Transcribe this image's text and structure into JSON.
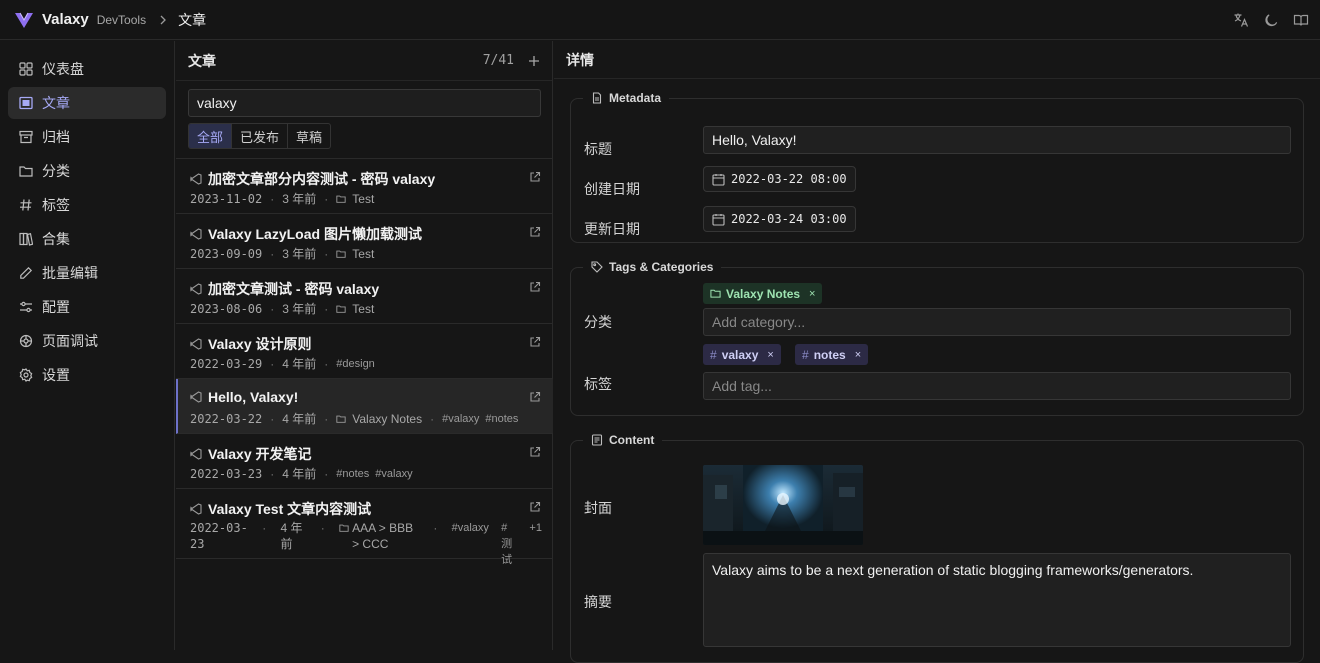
{
  "topbar": {
    "brand": "Valaxy",
    "sub": "DevTools",
    "crumb": "文章",
    "icons": [
      "translate-icon",
      "moon-icon",
      "book-icon"
    ]
  },
  "sidebar": {
    "items": [
      {
        "label": "仪表盘",
        "icon": "grid-icon"
      },
      {
        "label": "文章",
        "icon": "document-icon",
        "active": true
      },
      {
        "label": "归档",
        "icon": "archive-icon"
      },
      {
        "label": "分类",
        "icon": "folder-icon"
      },
      {
        "label": "标签",
        "icon": "hash-icon"
      },
      {
        "label": "合集",
        "icon": "books-icon"
      },
      {
        "label": "批量编辑",
        "icon": "pencil-icon"
      },
      {
        "label": "配置",
        "icon": "sliders-icon"
      },
      {
        "label": "页面调试",
        "icon": "bug-icon"
      },
      {
        "label": "设置",
        "icon": "gear-icon"
      }
    ]
  },
  "list": {
    "title": "文章",
    "count": "7/41",
    "add": "+",
    "search_value": "valaxy",
    "filters": [
      "全部",
      "已发布",
      "草稿"
    ],
    "active_filter": "全部",
    "posts": [
      {
        "title": "加密文章部分内容测试 - 密码 valaxy",
        "date": "2023-11-02",
        "ago": "3 年前",
        "category": "Test",
        "tags": []
      },
      {
        "title": "Valaxy LazyLoad 图片懒加载测试",
        "date": "2023-09-09",
        "ago": "3 年前",
        "category": "Test",
        "tags": []
      },
      {
        "title": "加密文章测试 - 密码 valaxy",
        "date": "2023-08-06",
        "ago": "3 年前",
        "category": "Test",
        "tags": []
      },
      {
        "title": "Valaxy 设计原则",
        "date": "2022-03-29",
        "ago": "4 年前",
        "category": "",
        "tags": [
          "#design"
        ]
      },
      {
        "title": "Hello, Valaxy!",
        "date": "2022-03-22",
        "ago": "4 年前",
        "category": "Valaxy Notes",
        "tags": [
          "#valaxy",
          "#notes"
        ],
        "selected": true
      },
      {
        "title": "Valaxy 开发笔记",
        "date": "2022-03-23",
        "ago": "4 年前",
        "category": "",
        "tags": [
          "#notes",
          "#valaxy"
        ]
      },
      {
        "title": "Valaxy Test 文章内容测试",
        "date": "2022-03-23",
        "ago": "4 年前",
        "category": "AAA > BBB > CCC",
        "tags": [
          "#valaxy",
          "#测试"
        ],
        "more": "+1"
      }
    ]
  },
  "detail": {
    "title": "详情",
    "metadata": {
      "legend": "Metadata",
      "title_label": "标题",
      "title_value": "Hello, Valaxy!",
      "created_label": "创建日期",
      "created_value": "2022-03-22 08:00",
      "updated_label": "更新日期",
      "updated_value": "2022-03-24 03:00"
    },
    "taxonomy": {
      "legend": "Tags & Categories",
      "category_label": "分类",
      "category_chip": "Valaxy Notes",
      "category_placeholder": "Add category...",
      "tags_label": "标签",
      "tag_chips": [
        "valaxy",
        "notes"
      ],
      "tag_placeholder": "Add tag...",
      "chip_remove": "×",
      "hash": "#"
    },
    "content": {
      "legend": "Content",
      "cover_label": "封面",
      "excerpt_label": "摘要",
      "excerpt_value": "Valaxy aims to be a next generation of static blogging frameworks/generators."
    }
  },
  "colors": {
    "accent": "#a6a9f5",
    "background": "#161616",
    "category_chip": "#1d3326",
    "tag_chip": "#2c2a45"
  }
}
